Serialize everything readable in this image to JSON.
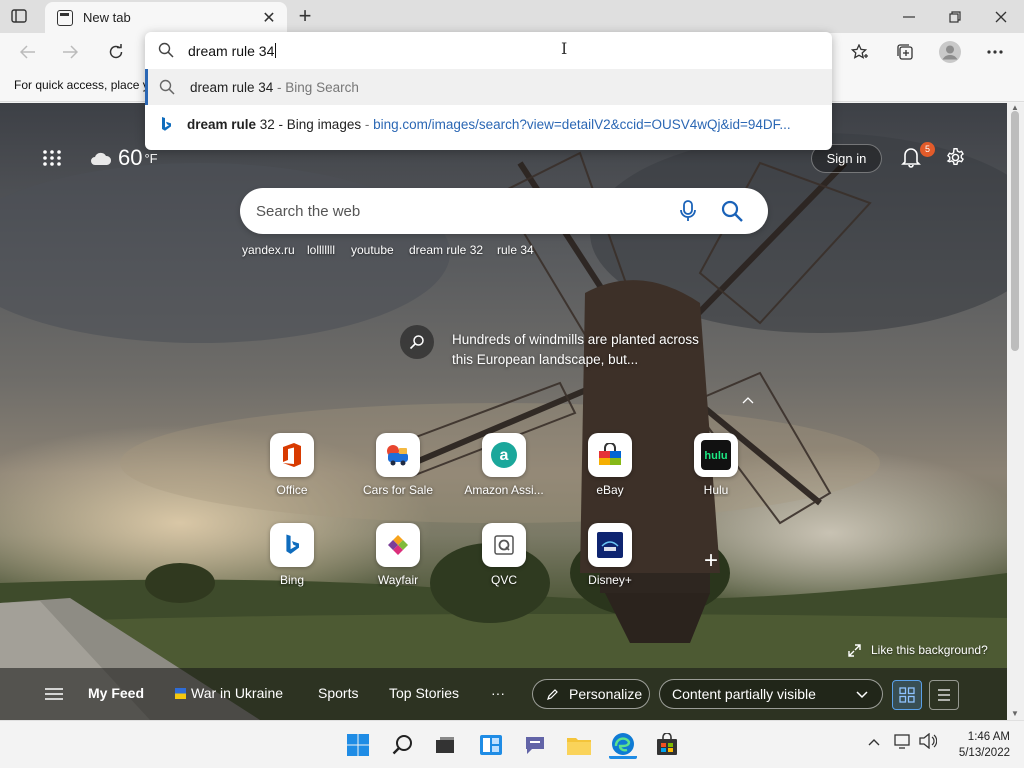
{
  "browser": {
    "tab_title": "New tab",
    "new_tab_symbol": "+",
    "close_tab_symbol": "✕",
    "window_controls": {
      "minimize": "—",
      "restore": "❐",
      "close": "✕"
    },
    "favorites_bar_text": "For quick access, place y"
  },
  "address_bar": {
    "typed_text": "dream rule 34",
    "suggestions": [
      {
        "icon": "search-icon",
        "main": "dream rule 34",
        "sep": " - ",
        "secondary": "Bing Search"
      },
      {
        "icon": "bing-icon",
        "bold": "dream rule",
        "main": " 32 - Bing images",
        "sep": " - ",
        "url": "bing.com/images/search?view=detailV2&ccid=OUSV4wQj&id=94DF..."
      }
    ]
  },
  "newtab": {
    "weather": {
      "icon": "cloud-icon",
      "temp": "60",
      "unit": "°F"
    },
    "signin_label": "Sign in",
    "notification_count": "5",
    "search_placeholder": "Search the web",
    "quick_links": [
      "yandex.ru",
      "lolllllll",
      "youtube",
      "dream rule 32",
      "rule 34"
    ],
    "fact_text": "Hundreds of windmills are planted across this European landscape, but...",
    "tiles": [
      {
        "label": "Office",
        "icon": "office-icon"
      },
      {
        "label": "Cars for Sale",
        "icon": "car-icon"
      },
      {
        "label": "Amazon Assi...",
        "icon": "amazon-icon"
      },
      {
        "label": "eBay",
        "icon": "ebay-icon"
      },
      {
        "label": "Hulu",
        "icon": "hulu-icon"
      },
      {
        "label": "Bing",
        "icon": "bing-icon"
      },
      {
        "label": "Wayfair",
        "icon": "wayfair-icon"
      },
      {
        "label": "QVC",
        "icon": "qvc-icon"
      },
      {
        "label": "Disney+",
        "icon": "disney-icon"
      }
    ],
    "add_tile_symbol": "+",
    "like_background": "Like this background?",
    "feed": {
      "my_feed": "My Feed",
      "items": [
        "War in Ukraine",
        "Sports",
        "Top Stories"
      ],
      "more": "···",
      "personalize": "Personalize",
      "content_visibility": "Content partially visible"
    }
  },
  "taskbar": {
    "time": "1:46 AM",
    "date": "5/13/2022",
    "tray_chevron": "^"
  },
  "colors": {
    "accent": "#2b67b4",
    "badge": "#e25b2a",
    "taskbar": "#f3f3f3"
  }
}
